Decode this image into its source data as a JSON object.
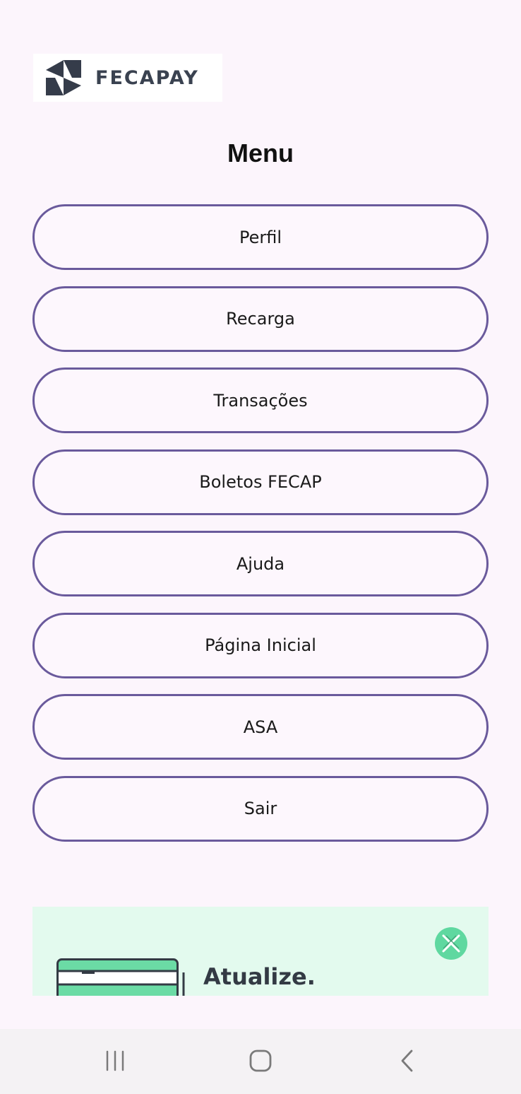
{
  "app": {
    "logo": {
      "name": "FECAPAY"
    }
  },
  "menu": {
    "title": "Menu",
    "items": [
      {
        "label": "Perfil"
      },
      {
        "label": "Recarga"
      },
      {
        "label": "Transações"
      },
      {
        "label": "Boletos FECAP"
      },
      {
        "label": "Ajuda"
      },
      {
        "label": "Página Inicial"
      },
      {
        "label": "ASA"
      },
      {
        "label": "Sair"
      }
    ]
  },
  "ad": {
    "headline": "Atualize.",
    "close_icon": "close-x-icon",
    "illustration_icon": "card-illustration-icon"
  },
  "navigation_bar": {
    "recents_icon": "recents-icon",
    "home_icon": "home-icon",
    "back_icon": "back-chevron-icon"
  },
  "colors": {
    "background": "#fcf5fc",
    "button_border": "#6a5a9c",
    "ad_background": "#e3faee",
    "ad_accent": "#5fd8a0",
    "logo_text": "#3a4250"
  }
}
